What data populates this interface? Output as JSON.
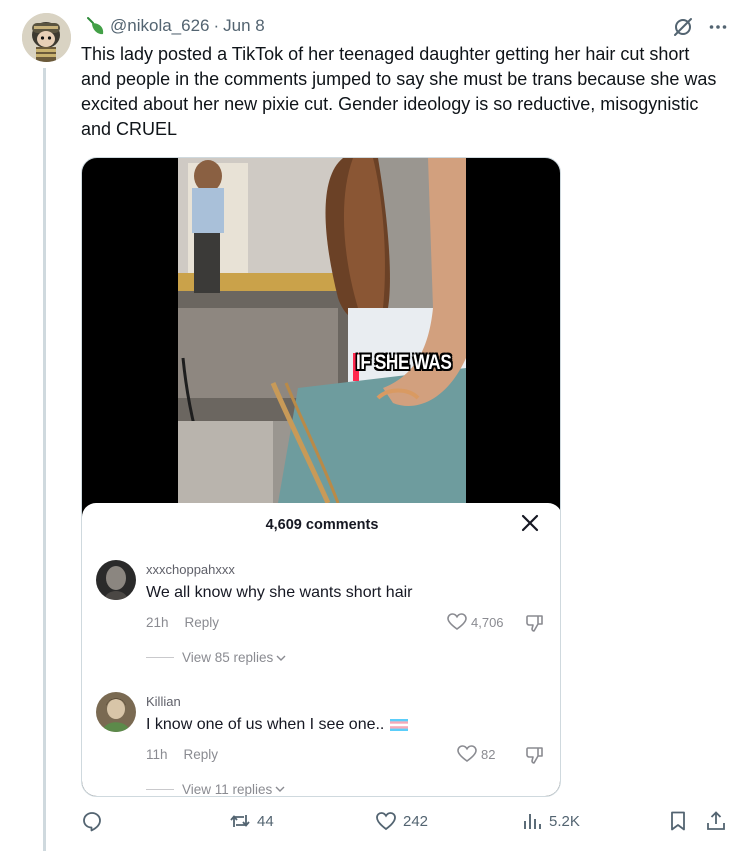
{
  "post": {
    "handle": "@nikola_626",
    "separator": "·",
    "date": "Jun 8",
    "text": "This lady posted a TikTok of her teenaged daughter getting her hair cut short and people in the comments jumped to say she must be trans because she was excited about her new pixie cut. Gender ideology is so reductive, misogynistic and CRUEL"
  },
  "media": {
    "caption": "IF SHE WAS",
    "comments_panel": {
      "title": "4,609 comments",
      "comments": [
        {
          "user": "xxxchoppahxxx",
          "text": "We all know why she wants short hair",
          "time": "21h",
          "reply_label": "Reply",
          "likes": "4,706",
          "view_replies": "View 85 replies"
        },
        {
          "user": "Killian",
          "text": "I know one of us when I see one..",
          "time": "11h",
          "reply_label": "Reply",
          "likes": "82",
          "view_replies": "View 11 replies"
        }
      ]
    }
  },
  "actions": {
    "reply_count": "",
    "repost_count": "44",
    "like_count": "242",
    "view_count": "5.2K"
  },
  "icons": [
    "leaf-icon",
    "grok-icon",
    "more-icon",
    "reply-icon",
    "repost-icon",
    "like-icon",
    "views-icon",
    "bookmark-icon",
    "share-icon",
    "close-icon",
    "heart-icon",
    "dislike-icon",
    "chevron-down-icon",
    "trans-flag-icon"
  ],
  "colors": {
    "accent": "#1d9bf0",
    "text": "#0f1419",
    "muted": "#536471",
    "tiktok_red": "#ff2a4e"
  }
}
